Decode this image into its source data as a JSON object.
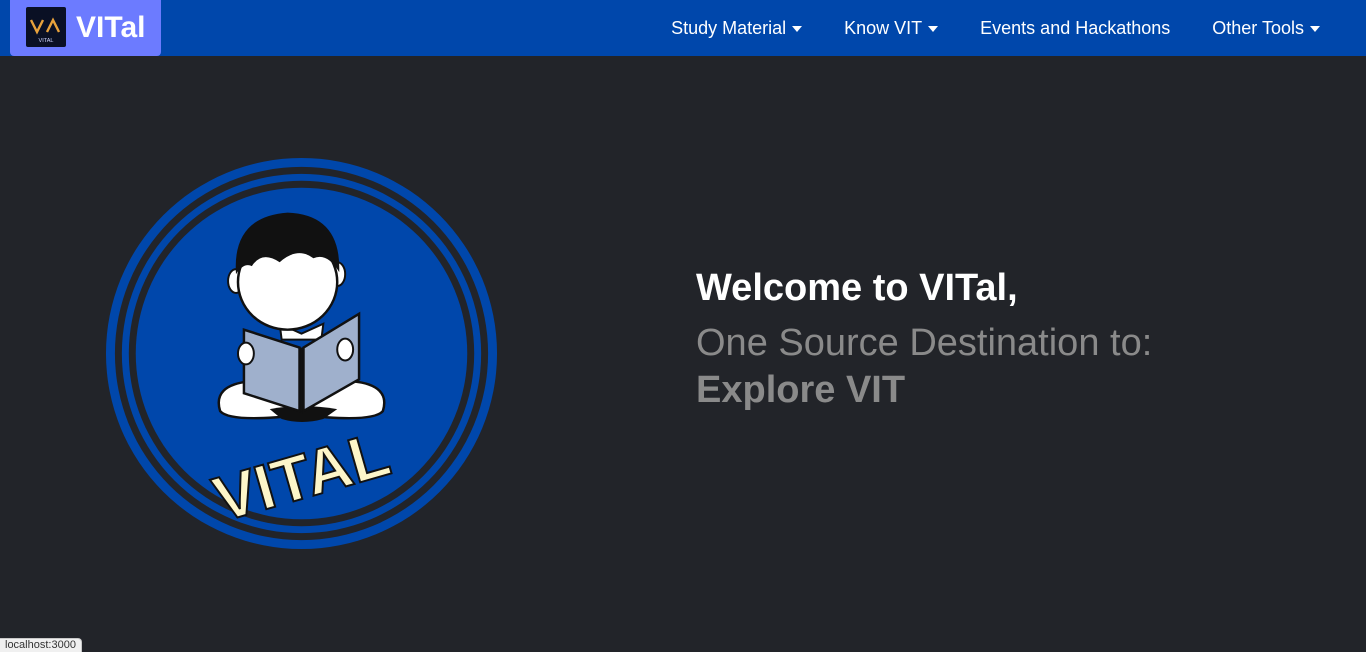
{
  "navbar": {
    "brand_name": "VITal",
    "brand_logo_text": "VITAL",
    "items": [
      {
        "label": "Study Material"
      },
      {
        "label": "Know VIT"
      },
      {
        "label": "Events and Hackathons"
      },
      {
        "label": "Other Tools"
      }
    ]
  },
  "hero": {
    "logo_text": "VITAL",
    "welcome": "Welcome to VITal,",
    "tagline": "One Source Destination to:",
    "typed_text": "Explore VIT"
  },
  "status_bar": {
    "url": "localhost:3000"
  },
  "colors": {
    "navbar": "#0047ab",
    "brand_bg": "#6c7bff",
    "page_bg": "#222429",
    "logo_blue": "#0047ab"
  }
}
